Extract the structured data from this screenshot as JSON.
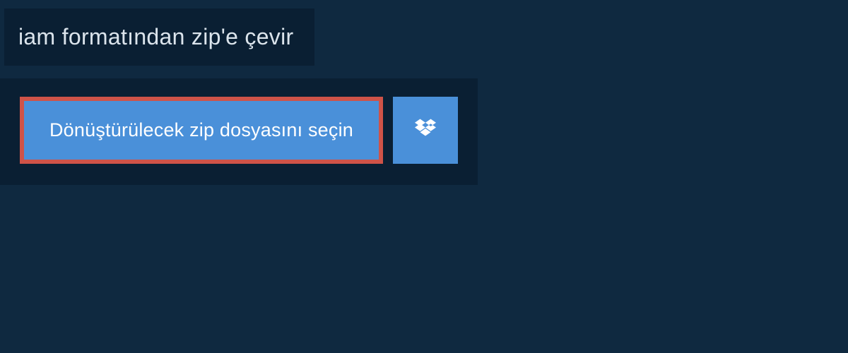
{
  "header": {
    "title": "iam formatından zip'e çevir"
  },
  "panel": {
    "select_file_label": "Dönüştürülecek zip dosyasını seçin",
    "dropbox_icon": "dropbox-icon"
  },
  "colors": {
    "page_bg": "#0f2940",
    "panel_bg": "#0a1f33",
    "button_bg": "#4a90d9",
    "button_border": "#cf5348",
    "text_light": "#ffffff",
    "text_header": "#dbe4ec"
  }
}
